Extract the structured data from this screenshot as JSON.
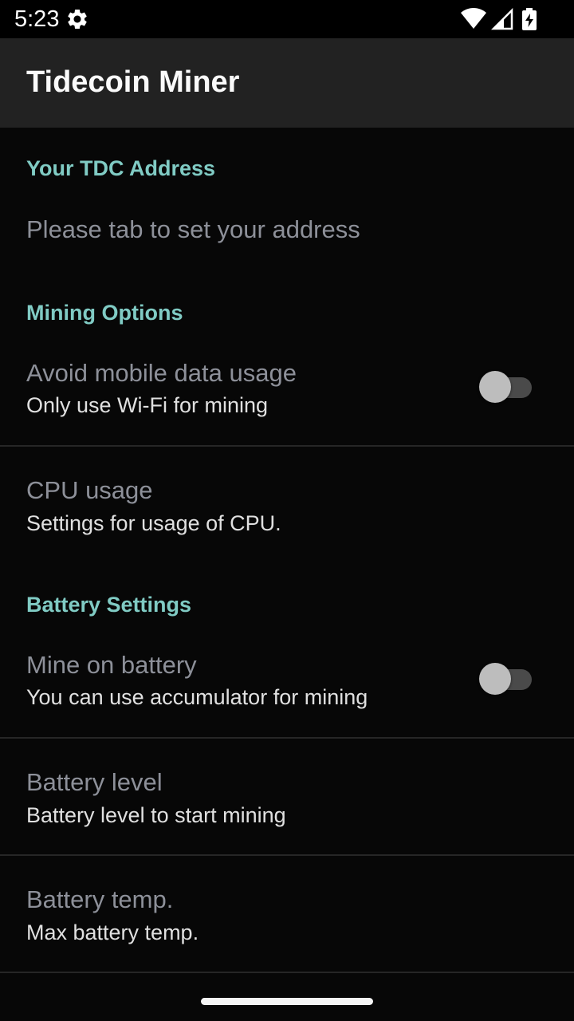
{
  "status_bar": {
    "time": "5:23",
    "icons": [
      "settings-gear-icon",
      "wifi-icon",
      "signal-icon",
      "battery-charging-icon"
    ]
  },
  "app_bar": {
    "title": "Tidecoin Miner"
  },
  "colors": {
    "accent": "#80cbc4",
    "background": "#070707",
    "app_bar": "#222222",
    "title_text": "#8d9099",
    "summary_text": "#e0e0e0"
  },
  "sections": {
    "address": {
      "header": "Your TDC Address",
      "item": {
        "title": "Please tab to set your address"
      }
    },
    "mining": {
      "header": "Mining Options",
      "avoid_mobile": {
        "title": "Avoid mobile data usage",
        "summary": "Only use Wi-Fi for mining",
        "enabled": false
      },
      "cpu_usage": {
        "title": "CPU usage",
        "summary": "Settings for usage of CPU."
      }
    },
    "battery": {
      "header": "Battery Settings",
      "mine_on_battery": {
        "title": "Mine on battery",
        "summary": "You can use accumulator for mining",
        "enabled": false
      },
      "battery_level": {
        "title": "Battery level",
        "summary": "Battery level to start mining"
      },
      "battery_temp": {
        "title": "Battery temp.",
        "summary": "Max battery temp."
      }
    }
  }
}
